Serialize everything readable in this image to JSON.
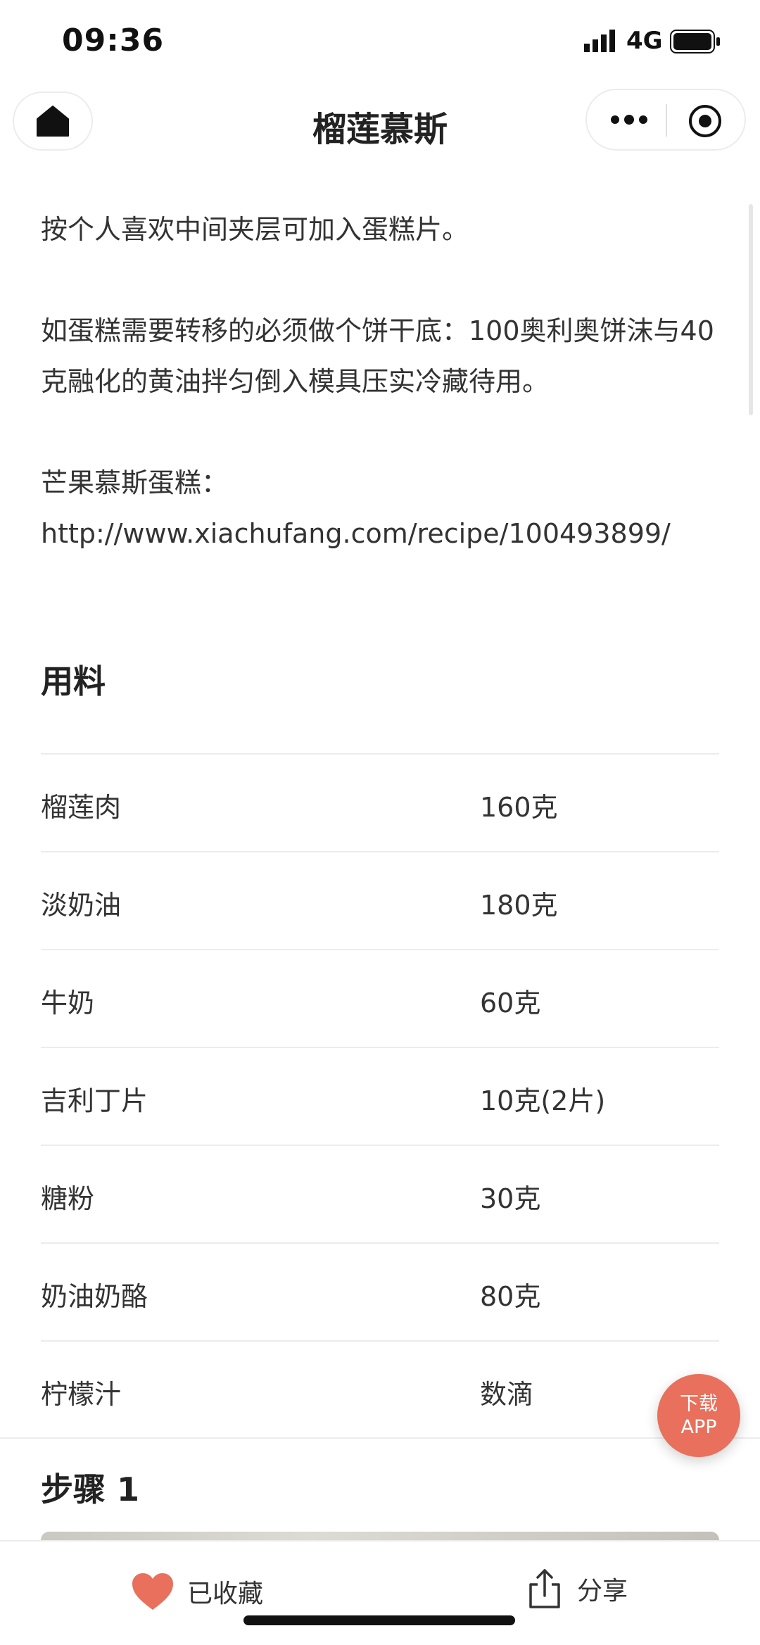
{
  "status_bar": {
    "time": "09:36",
    "network": "4G"
  },
  "nav": {
    "title": "榴莲慕斯"
  },
  "content": {
    "paragraphs": [
      "按个人喜欢中间夹层可加入蛋糕片。",
      "如蛋糕需要转移的必须做个饼干底：100奥利奥饼沫与40克融化的黄油拌匀倒入模具压实冷藏待用。",
      "芒果慕斯蛋糕：http://www.xiachufang.com/recipe/100493899/"
    ]
  },
  "ingredients": {
    "title": "用料",
    "items": [
      {
        "name": "榴莲肉",
        "qty": "160克"
      },
      {
        "name": "淡奶油",
        "qty": "180克"
      },
      {
        "name": "牛奶",
        "qty": "60克"
      },
      {
        "name": "吉利丁片",
        "qty": "10克(2片)"
      },
      {
        "name": "糖粉",
        "qty": "30克"
      },
      {
        "name": "奶油奶酪",
        "qty": "80克"
      },
      {
        "name": "柠檬汁",
        "qty": "数滴"
      }
    ]
  },
  "steps": {
    "step1_title": "步骤 1"
  },
  "download_fab": {
    "line1": "下载",
    "line2": "APP"
  },
  "bottom_bar": {
    "favorite_label": "已收藏",
    "share_label": "分享"
  },
  "colors": {
    "accent": "#e8705c",
    "text": "#333333",
    "divider": "#ececec"
  },
  "icons": {
    "home": "home-icon",
    "menu": "more-dots-icon",
    "close": "close-miniprogram-icon",
    "favorite": "heart-icon",
    "share": "share-icon"
  }
}
